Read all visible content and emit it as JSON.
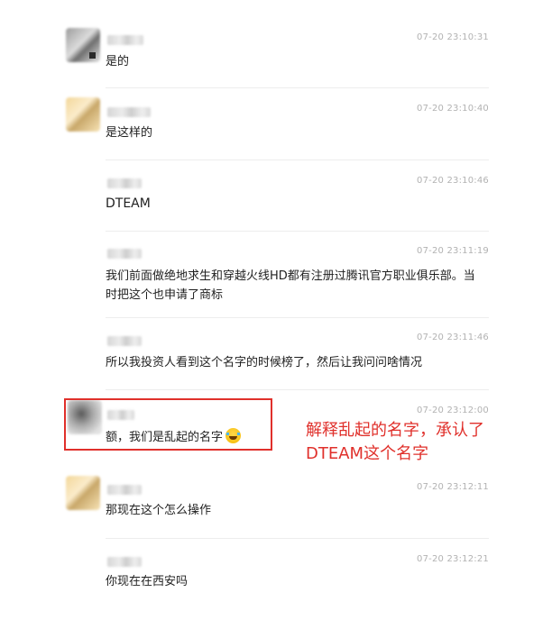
{
  "messages": [
    {
      "time": "07-20 23:10:31",
      "text": "是的"
    },
    {
      "time": "07-20 23:10:40",
      "text": "是这样的"
    },
    {
      "time": "07-20 23:10:46",
      "text": "DTEAM"
    },
    {
      "time": "07-20 23:11:19",
      "text": "我们前面做绝地求生和穿越火线HD都有注册过腾讯官方职业俱乐部。当时把这个也申请了商标"
    },
    {
      "time": "07-20 23:11:46",
      "text": "所以我投资人看到这个名字的时候榜了，然后让我问问啥情况"
    },
    {
      "time": "07-20 23:12:00",
      "text": "额，我们是乱起的名字"
    },
    {
      "time": "07-20 23:12:11",
      "text": "那现在这个怎么操作"
    },
    {
      "time": "07-20 23:12:21",
      "text": "你现在在西安吗"
    }
  ],
  "annotation": {
    "text": "解释乱起的名字，承认了DTEAM这个名字",
    "color": "#e0302b"
  },
  "icons": {
    "emoji": "laughing-crying-emoji-icon"
  }
}
